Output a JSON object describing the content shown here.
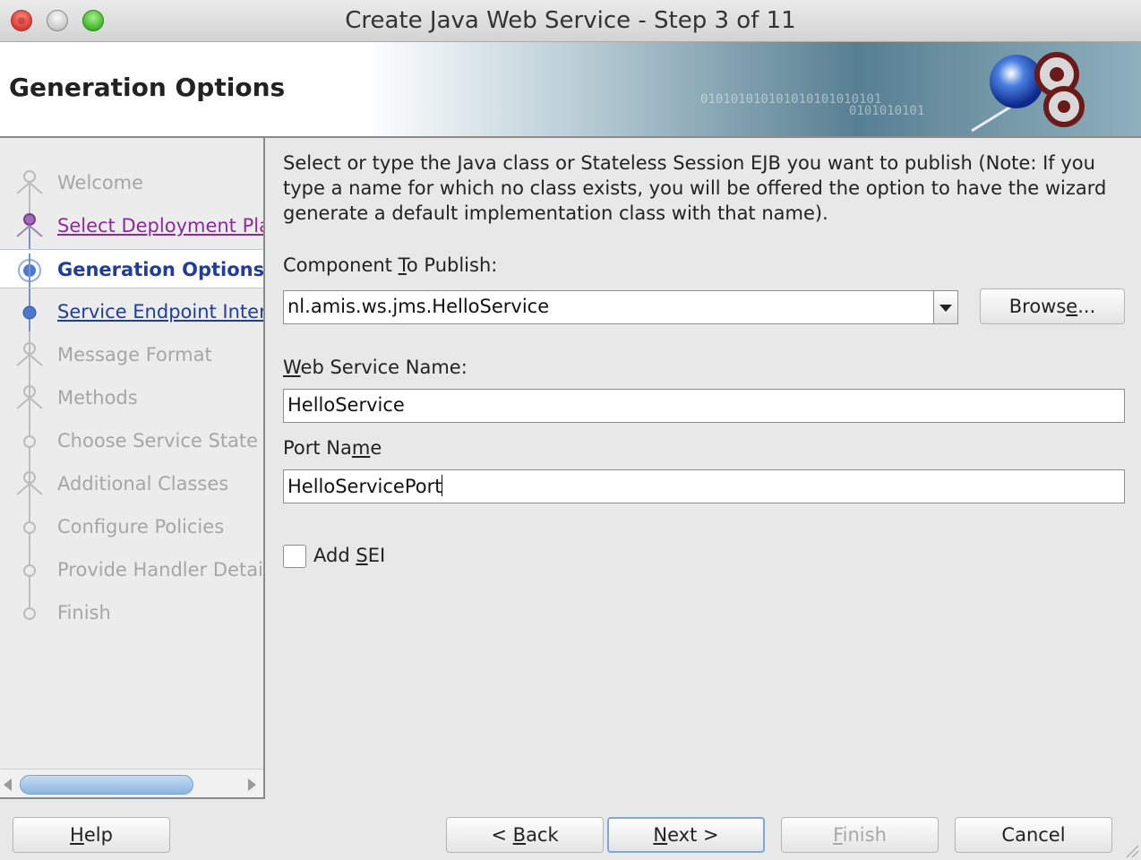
{
  "window": {
    "title": "Create Java Web Service - Step 3 of 11"
  },
  "banner": {
    "title": "Generation Options",
    "binary_line1": "010101010101010101010101",
    "binary_line2": "0101010101"
  },
  "nav": {
    "items": [
      {
        "label": "Welcome",
        "state": "disabled"
      },
      {
        "label": "Select Deployment Platform",
        "state": "visited"
      },
      {
        "label": "Generation Options",
        "state": "current"
      },
      {
        "label": "Service Endpoint Interface",
        "state": "link"
      },
      {
        "label": "Message Format",
        "state": "disabled"
      },
      {
        "label": "Methods",
        "state": "disabled"
      },
      {
        "label": "Choose Service State",
        "state": "disabled"
      },
      {
        "label": "Additional Classes",
        "state": "disabled"
      },
      {
        "label": "Configure Policies",
        "state": "disabled"
      },
      {
        "label": "Provide Handler Details",
        "state": "disabled"
      },
      {
        "label": "Finish",
        "state": "disabled"
      }
    ]
  },
  "main": {
    "description": "Select or type the Java class or Stateless Session EJB you want to publish (Note: If you type a name for which no class exists, you will be offered the option to have the wizard generate a default implementation class with that name).",
    "component": {
      "label_pre": "Component ",
      "label_mn": "T",
      "label_post": "o Publish:",
      "value": "nl.amis.ws.jms.HelloService",
      "browse_pre": "Brows",
      "browse_mn": "e",
      "browse_post": "..."
    },
    "service_name": {
      "label_mn": "W",
      "label_post": "eb Service Name:",
      "value": "HelloService"
    },
    "port_name": {
      "label_pre": "Port Na",
      "label_mn": "m",
      "label_post": "e",
      "value": "HelloServicePort"
    },
    "add_sei": {
      "label_pre": "Add ",
      "label_mn": "S",
      "label_post": "EI",
      "checked": false
    }
  },
  "footer": {
    "help_mn": "H",
    "help_post": "elp",
    "back_pre": "< ",
    "back_mn": "B",
    "back_post": "ack",
    "next_mn": "N",
    "next_post": "ext >",
    "finish_mn": "F",
    "finish_post": "inish",
    "cancel": "Cancel"
  },
  "colors": {
    "accent": "#1f3d9c",
    "visited": "#8c2a9c",
    "disabled": "#a6a6a6"
  }
}
